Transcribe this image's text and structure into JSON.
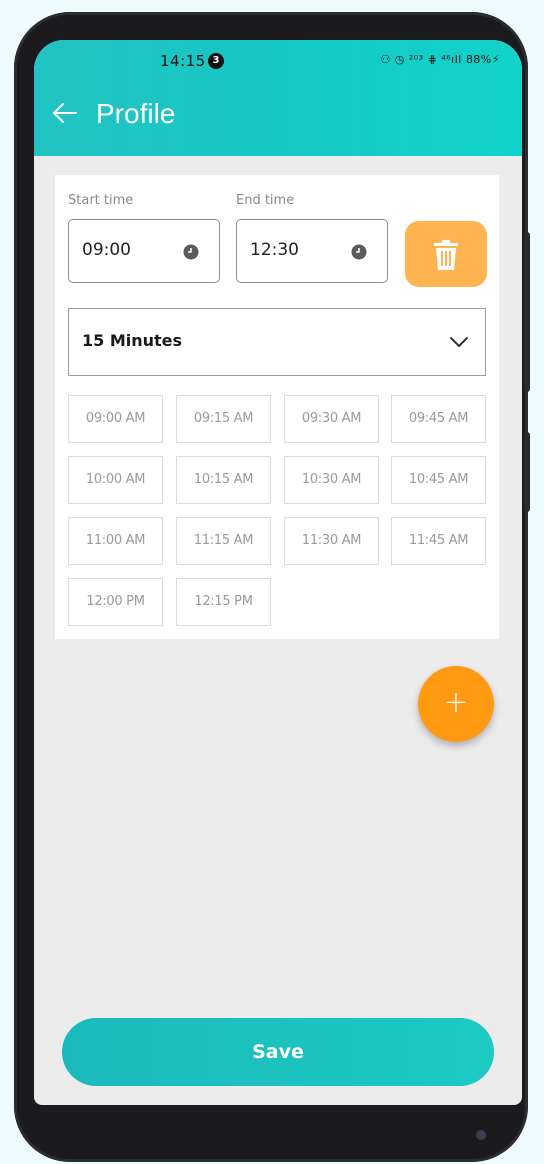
{
  "status_bar": {
    "time": "14:15",
    "notif_count": "3",
    "indicators": "⚇ ◷ ²⁰³ ⋕ ⁴⁶ıll 88%⚡"
  },
  "header": {
    "title": "Profile",
    "back_icon": "arrow-left-icon"
  },
  "schedule": {
    "start_label": "Start time",
    "start_value": "09:00",
    "end_label": "End time",
    "end_value": "12:30",
    "delete_icon": "trash-icon",
    "interval": "15 Minutes",
    "slots": [
      "09:00 AM",
      "09:15 AM",
      "09:30 AM",
      "09:45 AM",
      "10:00 AM",
      "10:15 AM",
      "10:30 AM",
      "10:45 AM",
      "11:00 AM",
      "11:15 AM",
      "11:30 AM",
      "11:45 AM",
      "12:00 PM",
      "12:15 PM"
    ]
  },
  "fab": {
    "label": "+"
  },
  "footer": {
    "save_label": "Save"
  },
  "colors": {
    "accent": "#1dc3c2",
    "orange": "#ff9a12",
    "trash_bg": "#ffb452"
  }
}
